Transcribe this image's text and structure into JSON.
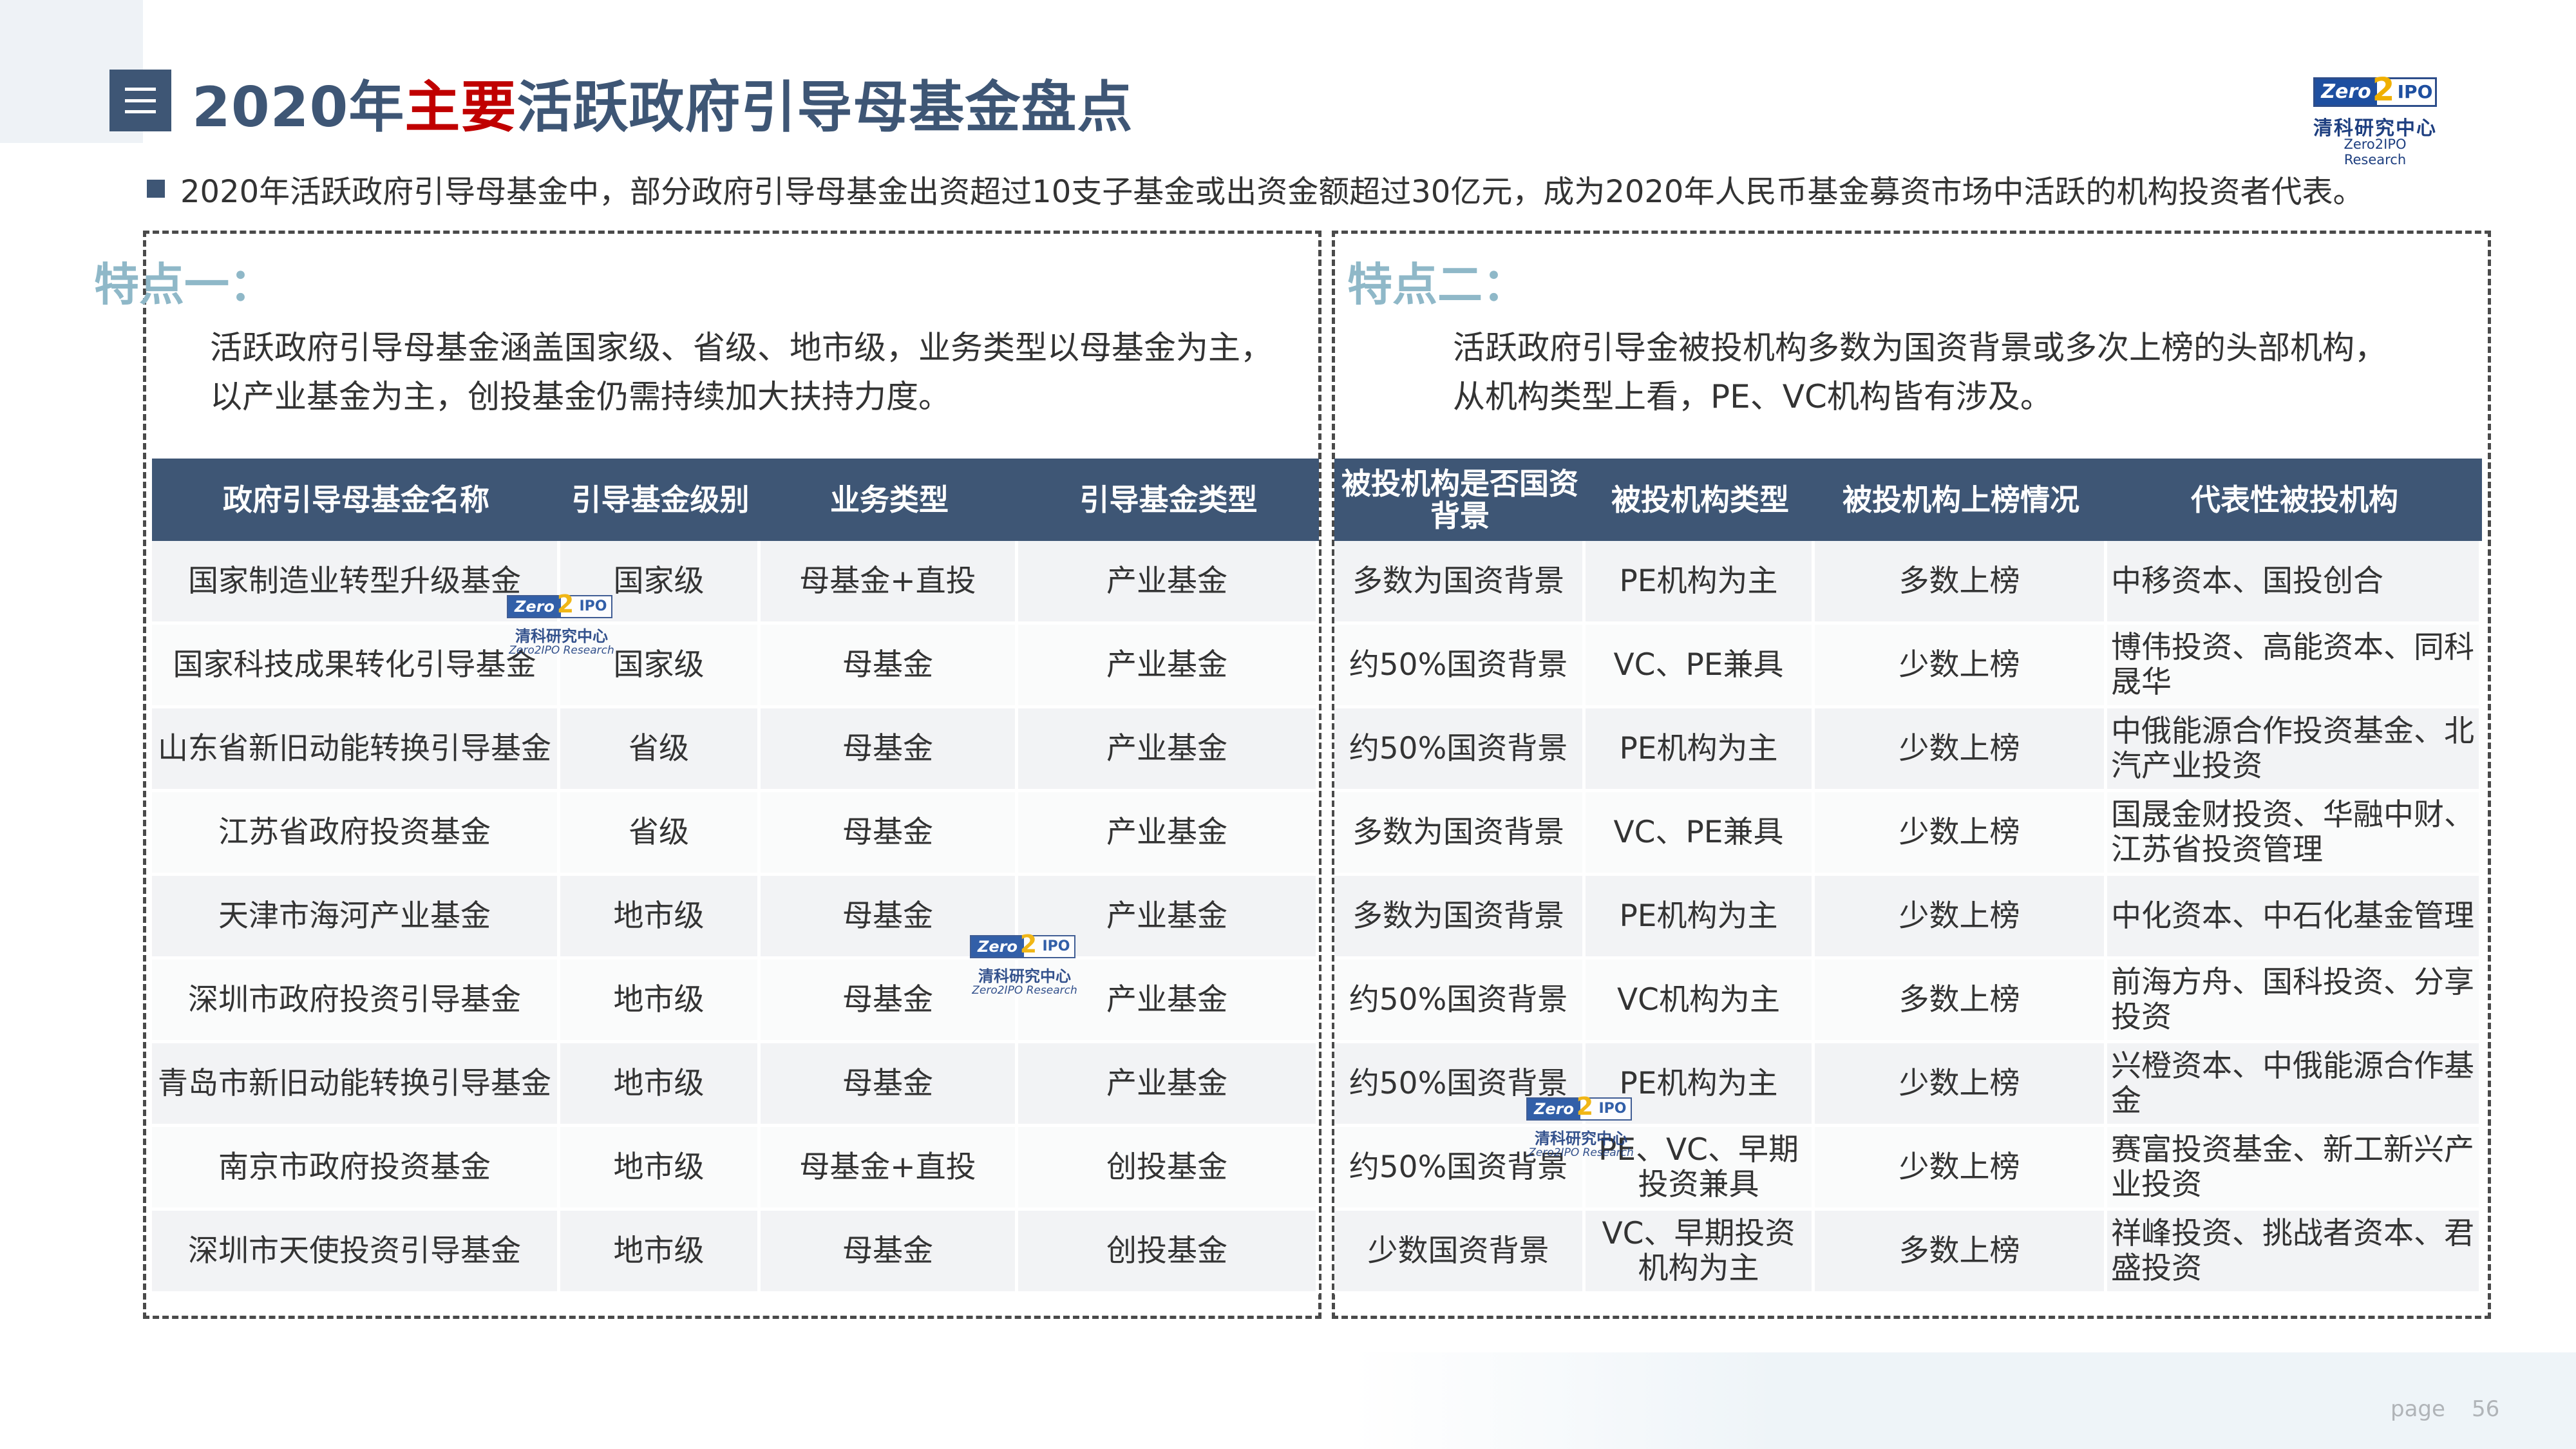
{
  "header": {
    "title_prefix": "2020年",
    "title_highlight": "主要",
    "title_suffix": "活跃政府引导母基金盘点",
    "menu_icon": "menu-icon"
  },
  "logo": {
    "badge_left": "Zero",
    "badge_two": "2",
    "badge_right": "IPO",
    "name_cn": "清科研究中心",
    "name_en": "Zero2IPO Research"
  },
  "summary": "2020年活跃政府引导母基金中，部分政府引导母基金出资超过10支子基金或出资金额超过30亿元，成为2020年人民币基金募资市场中活跃的机构投资者代表。",
  "feature_one": {
    "title": "特点一：",
    "desc_lines": [
      "活跃政府引导母基金涵盖国家级、省级、地市级，业务类型以母基金为主，",
      "以产业基金为主，创投基金仍需持续加大扶持力度。"
    ]
  },
  "feature_two": {
    "title": "特点二：",
    "desc_lines": [
      "活跃政府引导金被投机构多数为国资背景或多次上榜的头部机构，",
      "从机构类型上看，PE、VC机构皆有涉及。"
    ]
  },
  "table_left": {
    "headers": [
      "政府引导母基金名称",
      "引导基金级别",
      "业务类型",
      "引导基金类型"
    ],
    "rows": [
      [
        "国家制造业转型升级基金",
        "国家级",
        "母基金+直投",
        "产业基金"
      ],
      [
        "国家科技成果转化引导基金",
        "国家级",
        "母基金",
        "产业基金"
      ],
      [
        "山东省新旧动能转换引导基金",
        "省级",
        "母基金",
        "产业基金"
      ],
      [
        "江苏省政府投资基金",
        "省级",
        "母基金",
        "产业基金"
      ],
      [
        "天津市海河产业基金",
        "地市级",
        "母基金",
        "产业基金"
      ],
      [
        "深圳市政府投资引导基金",
        "地市级",
        "母基金",
        "产业基金"
      ],
      [
        "青岛市新旧动能转换引导基金",
        "地市级",
        "母基金",
        "产业基金"
      ],
      [
        "南京市政府投资基金",
        "地市级",
        "母基金+直投",
        "创投基金"
      ],
      [
        "深圳市天使投资引导基金",
        "地市级",
        "母基金",
        "创投基金"
      ]
    ]
  },
  "table_right": {
    "headers": [
      "被投机构是否国资背景",
      "被投机构类型",
      "被投机构上榜情况",
      "代表性被投机构"
    ],
    "rows": [
      [
        "多数为国资背景",
        "PE机构为主",
        "多数上榜",
        "中移资本、国投创合"
      ],
      [
        "约50%国资背景",
        "VC、PE兼具",
        "少数上榜",
        "博伟投资、高能资本、同科晟华"
      ],
      [
        "约50%国资背景",
        "PE机构为主",
        "少数上榜",
        "中俄能源合作投资基金、北汽产业投资"
      ],
      [
        "多数为国资背景",
        "VC、PE兼具",
        "少数上榜",
        "国晟金财投资、华融中财、江苏省投资管理"
      ],
      [
        "多数为国资背景",
        "PE机构为主",
        "少数上榜",
        "中化资本、中石化基金管理"
      ],
      [
        "约50%国资背景",
        "VC机构为主",
        "多数上榜",
        "前海方舟、国科投资、分享投资"
      ],
      [
        "约50%国资背景",
        "PE机构为主",
        "少数上榜",
        "兴橙资本、中俄能源合作基金"
      ],
      [
        "约50%国资背景",
        "PE、VC、早期投资兼具",
        "少数上榜",
        "赛富投资基金、新工新兴产业投资"
      ],
      [
        "少数国资背景",
        "VC、早期投资机构为主",
        "多数上榜",
        "祥峰投资、挑战者资本、君盛投资"
      ]
    ]
  },
  "footer": {
    "page_label": "page",
    "page_number": "56"
  }
}
